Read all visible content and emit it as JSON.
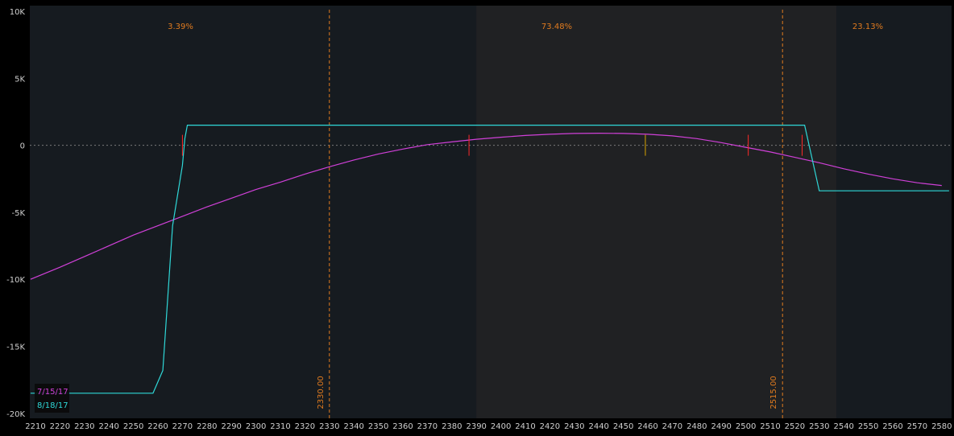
{
  "chart_data": {
    "type": "line",
    "xlim": [
      2208,
      2583
    ],
    "ylim": [
      -20000,
      10000
    ],
    "x_ticks": [
      2210,
      2220,
      2230,
      2240,
      2250,
      2260,
      2270,
      2280,
      2290,
      2300,
      2310,
      2320,
      2330,
      2340,
      2350,
      2360,
      2370,
      2380,
      2390,
      2400,
      2410,
      2420,
      2430,
      2440,
      2450,
      2460,
      2470,
      2480,
      2490,
      2500,
      2510,
      2520,
      2530,
      2540,
      2550,
      2560,
      2570,
      2580
    ],
    "y_ticks": [
      {
        "value": 10000,
        "label": "10K"
      },
      {
        "value": 5000,
        "label": "5K"
      },
      {
        "value": 0,
        "label": "0"
      },
      {
        "value": -5000,
        "label": "-5K"
      },
      {
        "value": -10000,
        "label": "-10K"
      },
      {
        "value": -15000,
        "label": "-15K"
      },
      {
        "value": -20000,
        "label": "-20K"
      }
    ],
    "zones": [
      {
        "from": 2208,
        "to": 2390,
        "label": "3.39%"
      },
      {
        "from": 2390,
        "to": 2537,
        "label": "73.48%"
      },
      {
        "from": 2537,
        "to": 2583,
        "label": "23.13%"
      }
    ],
    "vertical_lines": [
      {
        "x": 2330,
        "label": "2330.00"
      },
      {
        "x": 2515,
        "label": "2515.00"
      }
    ],
    "series": [
      {
        "name": "7/15/17",
        "color": "#d040d8",
        "x": [
          2208,
          2220,
          2230,
          2240,
          2250,
          2260,
          2270,
          2280,
          2290,
          2300,
          2310,
          2320,
          2330,
          2340,
          2350,
          2360,
          2370,
          2380,
          2390,
          2400,
          2410,
          2420,
          2430,
          2440,
          2450,
          2460,
          2470,
          2480,
          2490,
          2500,
          2510,
          2520,
          2530,
          2540,
          2550,
          2560,
          2570,
          2580
        ],
        "y": [
          -10000,
          -9100,
          -8300,
          -7500,
          -6700,
          -6000,
          -5300,
          -4600,
          -3950,
          -3300,
          -2750,
          -2150,
          -1600,
          -1100,
          -650,
          -280,
          50,
          250,
          450,
          600,
          730,
          820,
          880,
          900,
          880,
          820,
          700,
          500,
          200,
          -150,
          -500,
          -900,
          -1300,
          -1750,
          -2150,
          -2500,
          -2800,
          -3000
        ]
      },
      {
        "name": "8/18/17",
        "color": "#2fd8d8",
        "x": [
          2208,
          2258,
          2262,
          2266,
          2270,
          2271,
          2272,
          2310,
          2400,
          2500,
          2512,
          2516,
          2524,
          2530,
          2540,
          2583
        ],
        "y": [
          -18500,
          -18500,
          -16800,
          -6000,
          -1500,
          500,
          1500,
          1500,
          1500,
          1500,
          1500,
          1500,
          1500,
          -3400,
          -3400,
          -3400
        ]
      }
    ],
    "markers": [
      {
        "x": 2270,
        "y": 0,
        "color": "#ff2a2a"
      },
      {
        "x": 2387,
        "y": 0,
        "color": "#ff2a2a"
      },
      {
        "x": 2501,
        "y": 0,
        "color": "#ff2a2a"
      },
      {
        "x": 2523,
        "y": 0,
        "color": "#ff2a2a"
      },
      {
        "x": 2459,
        "y": 0,
        "color": "#d9a400"
      }
    ]
  }
}
